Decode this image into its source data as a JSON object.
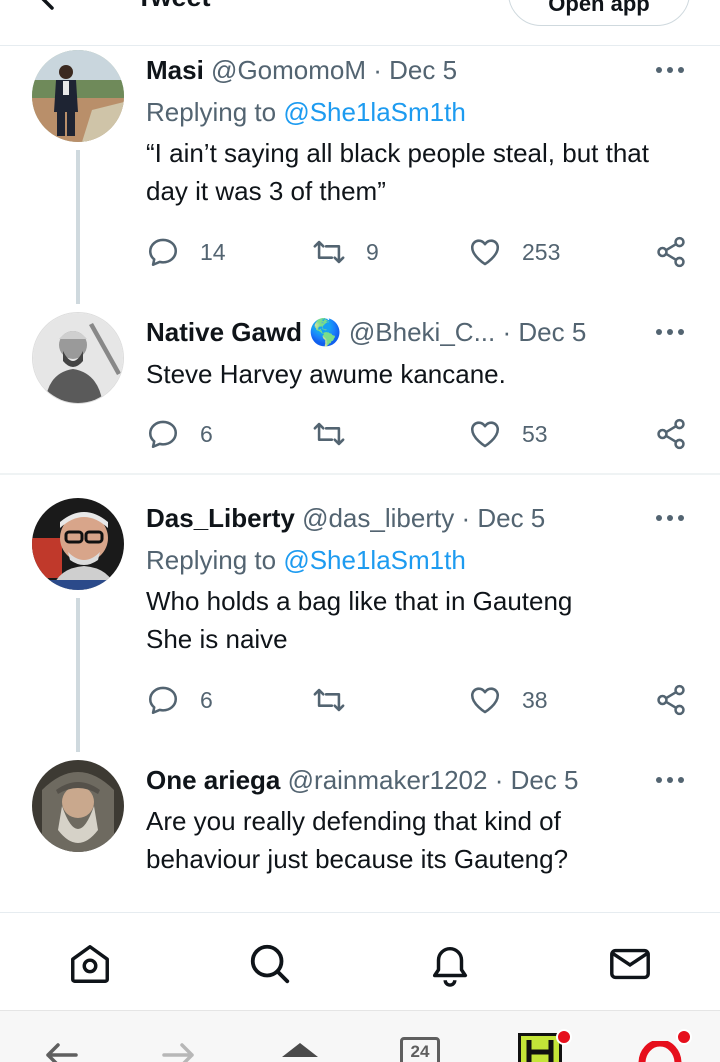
{
  "header": {
    "title": "Tweet",
    "open_app": "Open app"
  },
  "tweets": [
    {
      "name": "Masi",
      "handle": "@GomomoM",
      "date": "· Dec 5",
      "replying_prefix": "Replying to",
      "replying_to": "@She1laSm1th",
      "text": "“I ain’t saying all black people steal, but that day it was 3 of them”",
      "replies": "14",
      "retweets": "9",
      "likes": "253"
    },
    {
      "name": "Native Gawd",
      "badge": "🌎",
      "handle": "@Bheki_C...",
      "date": "· Dec 5",
      "text": "Steve Harvey awume kancane.",
      "replies": "6",
      "retweets": "",
      "likes": "53"
    },
    {
      "name": "Das_Liberty",
      "handle": "@das_liberty",
      "date": "· Dec 5",
      "replying_prefix": "Replying to",
      "replying_to": "@She1laSm1th",
      "text_line1": "Who holds a bag like that in Gauteng",
      "text_line2": "She is naive",
      "replies": "6",
      "retweets": "",
      "likes": "38"
    },
    {
      "name": "One ariega",
      "handle": "@rainmaker1202",
      "date": "· Dec 5",
      "text": "Are you really defending that kind of behaviour just because its Gauteng?"
    }
  ],
  "tabbar": {
    "items": [
      "home-icon",
      "search-icon",
      "notifications-icon",
      "messages-icon"
    ]
  },
  "browser": {
    "tab_count": "24",
    "colors": {
      "app_badge": "#c4e538",
      "opera_red": "#e60f1c"
    }
  },
  "colors": {
    "link": "#1d9bf0",
    "secondary_text": "#536471",
    "primary_text": "#0f1419"
  }
}
